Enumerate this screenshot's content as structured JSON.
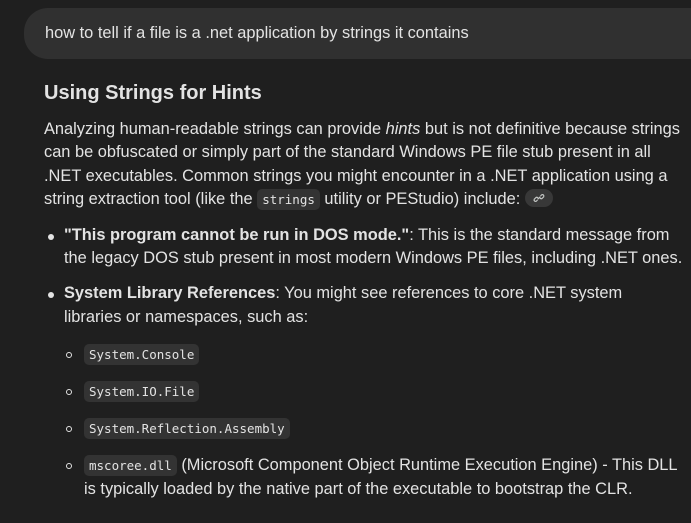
{
  "query": {
    "text": "how to tell if a file is a .net application by strings it contains"
  },
  "answer": {
    "heading": "Using Strings for Hints",
    "intro": {
      "part1": "Analyzing human-readable strings can provide ",
      "italic": "hints",
      "part2": " but is not definitive because strings can be obfuscated or simply part of the standard Windows PE file stub present in all .NET executables. Common strings you might encounter in a .NET application using a string extraction tool (like the ",
      "code": "strings",
      "part3": " utility or PEStudio) include:"
    },
    "bullets": [
      {
        "bold": "\"This program cannot be run in DOS mode.\"",
        "text": ": This is the standard message from the legacy DOS stub present in most modern Windows PE files, including .NET ones."
      },
      {
        "bold": "System Library References",
        "text": ": You might see references to core .NET system libraries or namespaces, such as:",
        "sub": [
          {
            "code": "System.Console",
            "text": ""
          },
          {
            "code": "System.IO.File",
            "text": ""
          },
          {
            "code": "System.Reflection.Assembly",
            "text": ""
          },
          {
            "code": "mscoree.dll",
            "text": " (Microsoft Component Object Runtime Execution Engine) - This DLL is typically loaded by the native part of the executable to bootstrap the CLR."
          }
        ]
      }
    ]
  },
  "icons": {
    "source_chip": "link-icon"
  }
}
